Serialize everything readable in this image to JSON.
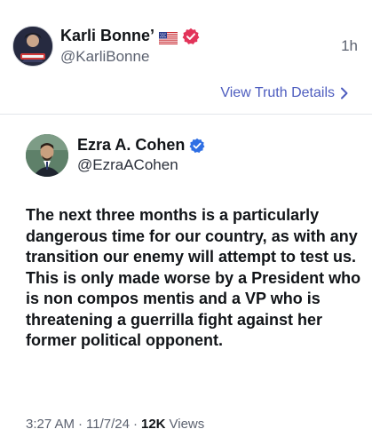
{
  "post": {
    "author_name": "Karli Bonne’",
    "author_handle": "@KarliBonne",
    "time_ago": "1h",
    "details_link": "View Truth Details",
    "icons": {
      "flag": "us-flag-icon",
      "verified": "verified-badge-icon",
      "chevron": "chevron-right-icon"
    },
    "verified_color": "#e2345a"
  },
  "quoted": {
    "author_name": "Ezra A. Cohen",
    "author_handle": "@EzraACohen",
    "verified_color": "#2f6fe4",
    "text": "The next three months is a particularly dangerous time for our country, as with any transition our enemy will attempt to test us. This is only made worse by a President who is non compos mentis and a VP who is threatening a guerrilla fight against her former political opponent.",
    "time": "3:27 AM",
    "separator": "·",
    "date": "11/7/24",
    "views_count": "12K",
    "views_label": "Views"
  }
}
